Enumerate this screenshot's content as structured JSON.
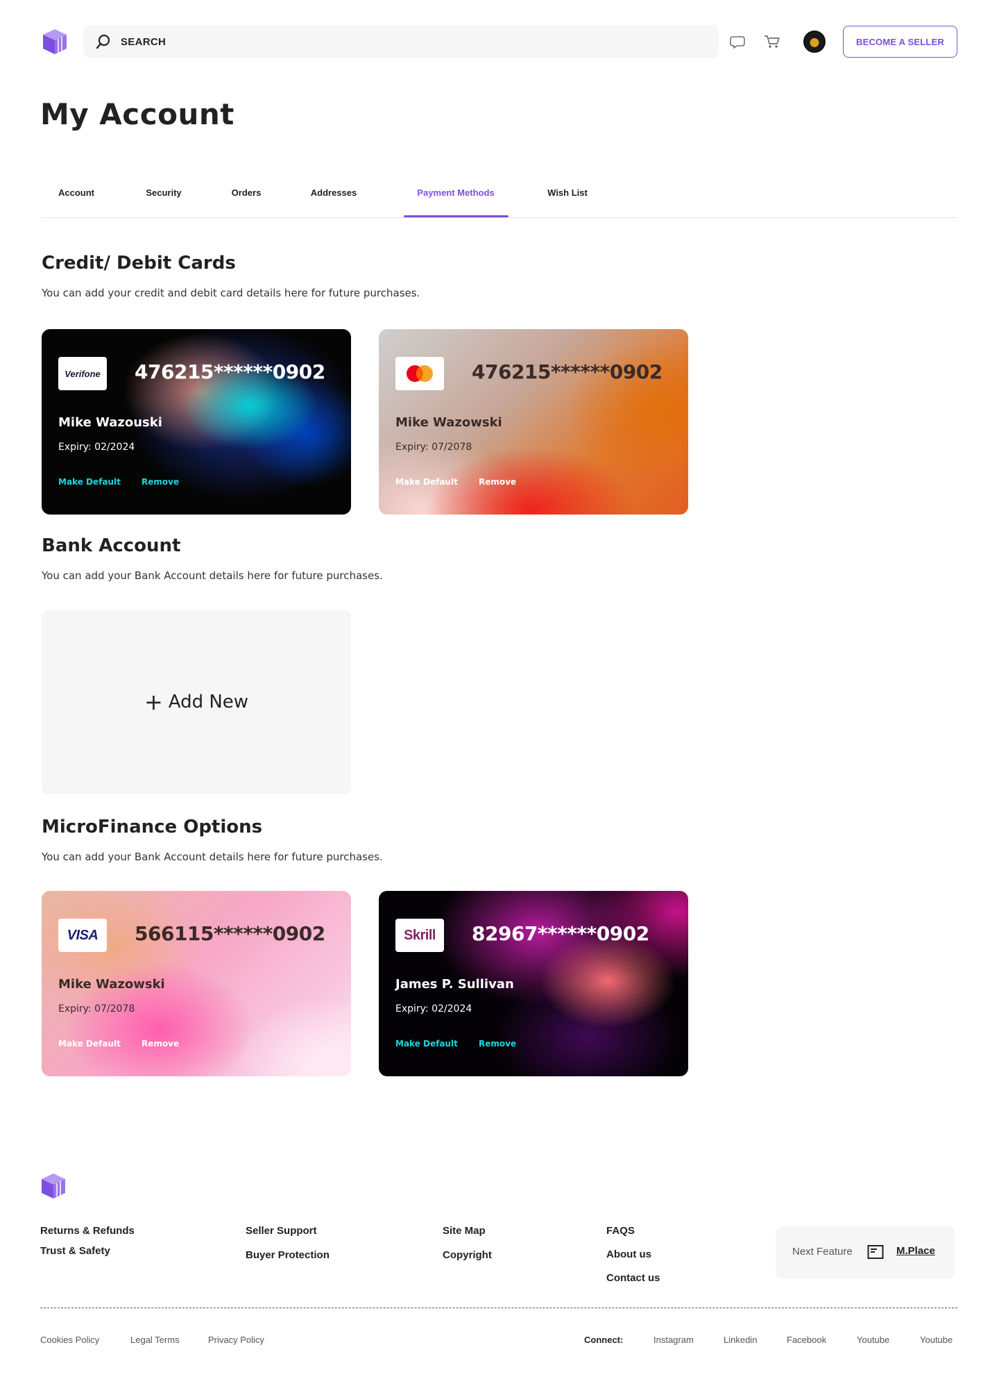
{
  "header": {
    "search_placeholder": "SEARCH",
    "become_seller": "BECOME A SELLER"
  },
  "page": {
    "title": "My Account"
  },
  "tabs": [
    {
      "label": "Account",
      "active": false
    },
    {
      "label": "Security",
      "active": false
    },
    {
      "label": "Orders",
      "active": false
    },
    {
      "label": "Addresses",
      "active": false
    },
    {
      "label": "Payment Methods",
      "active": true
    },
    {
      "label": "Wish List",
      "active": false
    }
  ],
  "credit_cards": {
    "title": "Credit/ Debit Cards",
    "description": "You can add your credit and debit card details here for future purchases.",
    "cards": [
      {
        "brand": "Verifone",
        "number": "476215******0902",
        "holder": "Mike Wazouski",
        "expiry": "Expiry: 02/2024",
        "make_default": "Make Default",
        "remove": "Remove"
      },
      {
        "brand": "mastercard",
        "number": "476215******0902",
        "holder": "Mike Wazowski",
        "expiry": "Expiry: 07/2078",
        "make_default": "Make Default",
        "remove": "Remove"
      }
    ]
  },
  "bank_account": {
    "title": "Bank Account",
    "description": "You can add your Bank Account details here for future purchases.",
    "add_new": "Add New"
  },
  "microfinance": {
    "title": "MicroFinance Options",
    "description": "You can add your Bank Account details here for future purchases.",
    "cards": [
      {
        "brand": "VISA",
        "number": "566115******0902",
        "holder": "Mike Wazowski",
        "expiry": "Expiry: 07/2078",
        "make_default": "Make Default",
        "remove": "Remove"
      },
      {
        "brand": "Skrill",
        "number": "82967******0902",
        "holder": "James P. Sullivan",
        "expiry": "Expiry: 02/2024",
        "make_default": "Make Default",
        "remove": "Remove"
      }
    ]
  },
  "footer": {
    "links": {
      "returns": "Returns & Refunds",
      "trust": "Trust & Safety",
      "seller_support": "Seller Support",
      "buyer_protection": "Buyer Protection",
      "site_map": "Site Map",
      "copyright": "Copyright",
      "faqs": "FAQS",
      "about": "About us",
      "contact": "Contact us"
    },
    "next_feature": {
      "label": "Next Feature",
      "link": "M.Place"
    },
    "bottom": {
      "cookies": "Cookies Policy",
      "legal": "Legal Terms",
      "privacy": "Privacy Policy",
      "connect": "Connect:",
      "instagram": "Instagram",
      "linkedin": "Linkedin",
      "facebook": "Facebook",
      "youtube1": "Youtube",
      "youtube2": "Youtube"
    }
  },
  "colors": {
    "accent": "#7b4fe0",
    "action_cyan": "#18d9de"
  }
}
